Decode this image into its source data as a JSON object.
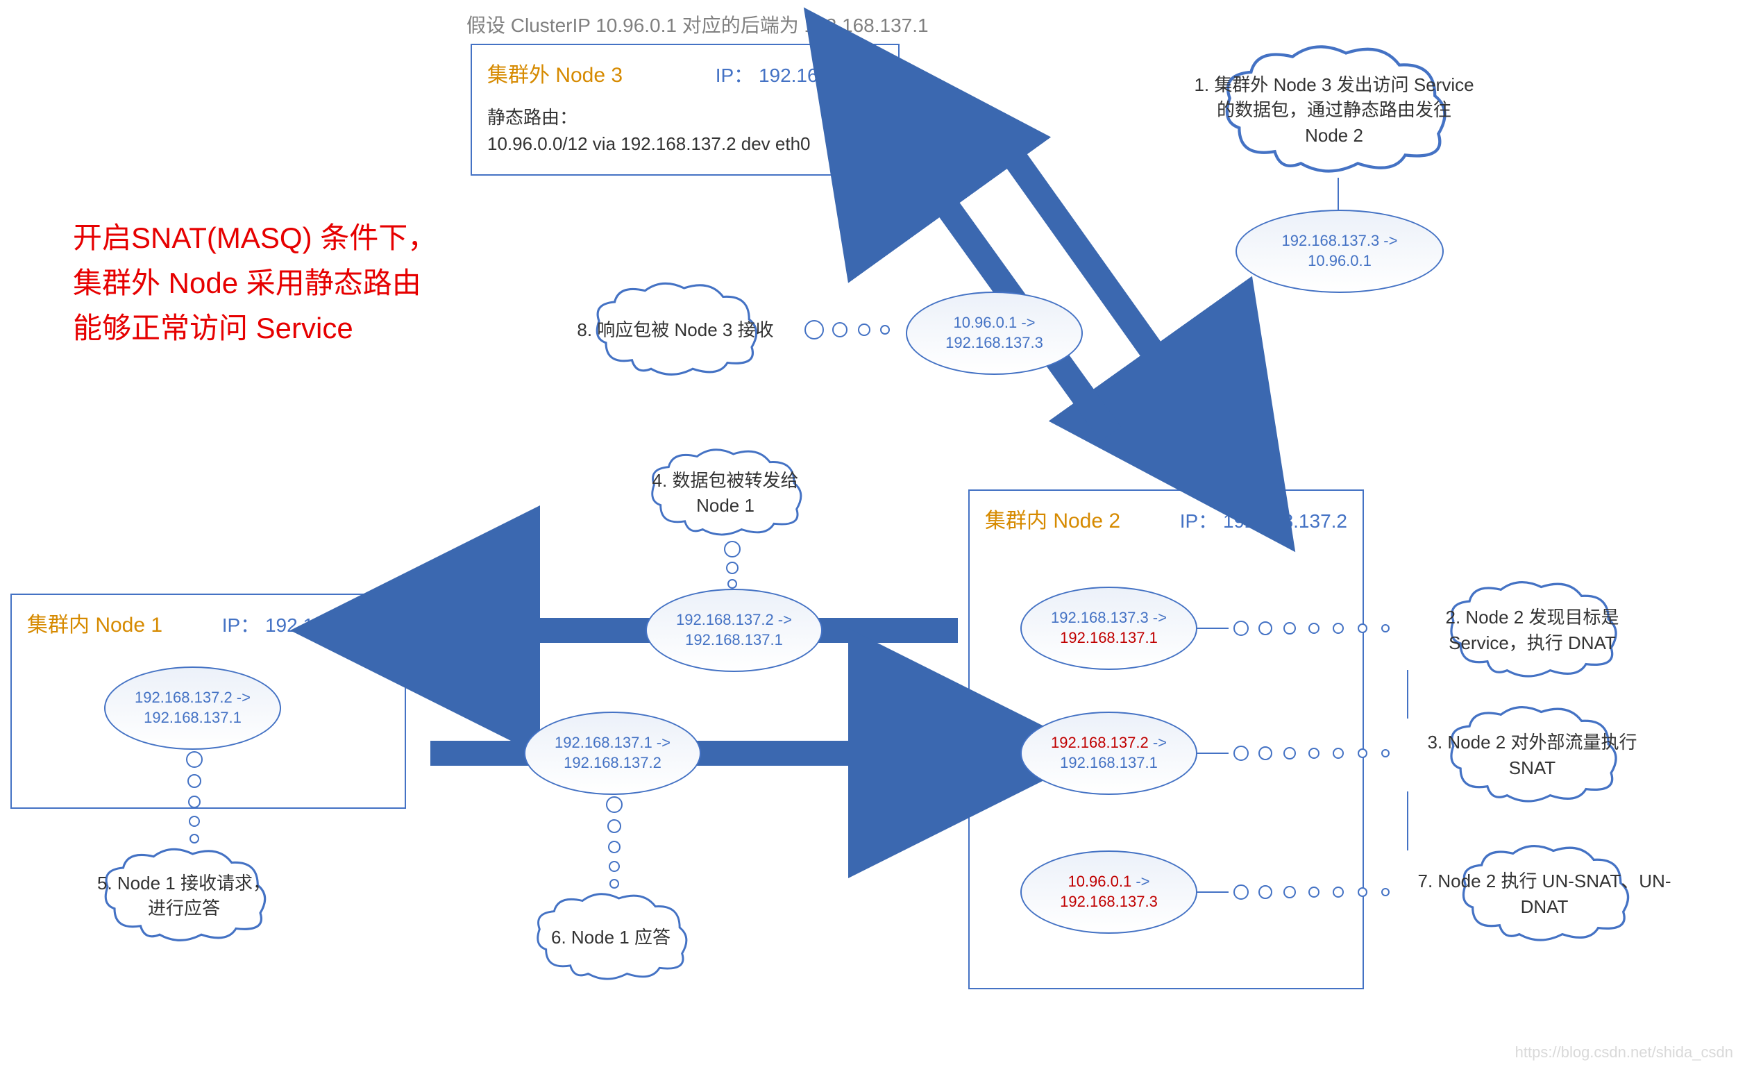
{
  "assumption": "假设 ClusterIP 10.96.0.1 对应的后端为 192.168.137.1",
  "red_title_l1": "开启SNAT(MASQ) 条件下，",
  "red_title_l2": "集群外 Node 采用静态路由",
  "red_title_l3": "能够正常访问 Service",
  "node3": {
    "label": "集群外 Node 3",
    "ip_prefix": "IP：",
    "ip": "192.168.137.3",
    "route_title": "静态路由：",
    "route": "10.96.0.0/12 via 192.168.137.2 dev eth0"
  },
  "node1": {
    "label": "集群内 Node 1",
    "ip_prefix": "IP：",
    "ip": "192.168.137.1"
  },
  "node2": {
    "label": "集群内 Node 2",
    "ip_prefix": "IP：",
    "ip": "192.168.137.2"
  },
  "packets": {
    "p1_src": "192.168.137.3 ->",
    "p1_dst": "10.96.0.1",
    "p8_src": "10.96.0.1 ->",
    "p8_dst": "192.168.137.3",
    "p4_src": "192.168.137.2 ->",
    "p4_dst": "192.168.137.1",
    "p6_src": "192.168.137.1 ->",
    "p6_dst": "192.168.137.2",
    "n1_src": "192.168.137.2 ->",
    "n1_dst": "192.168.137.1",
    "n2a_src": "192.168.137.3 ->",
    "n2a_dst": "192.168.137.1",
    "n2b_src": "192.168.137.2",
    "n2b_arrow": " ->",
    "n2b_dst": "192.168.137.1",
    "n2c_src": "10.96.0.1",
    "n2c_arrow": " ->",
    "n2c_dst": "192.168.137.3"
  },
  "clouds": {
    "c1": "1. 集群外 Node 3 发出访问 Service 的数据包，通过静态路由发往 Node 2",
    "c2": "2. Node 2 发现目标是 Service，执行 DNAT",
    "c3": "3. Node 2 对外部流量执行 SNAT",
    "c4": "4. 数据包被转发给 Node 1",
    "c5": "5. Node 1 接收请求，进行应答",
    "c6": "6. Node 1 应答",
    "c7": "7. Node 2 执行 UN-SNAT、UN-DNAT",
    "c8": "8. 响应包被 Node 3 接收"
  },
  "watermark": "https://blog.csdn.net/shida_csdn"
}
